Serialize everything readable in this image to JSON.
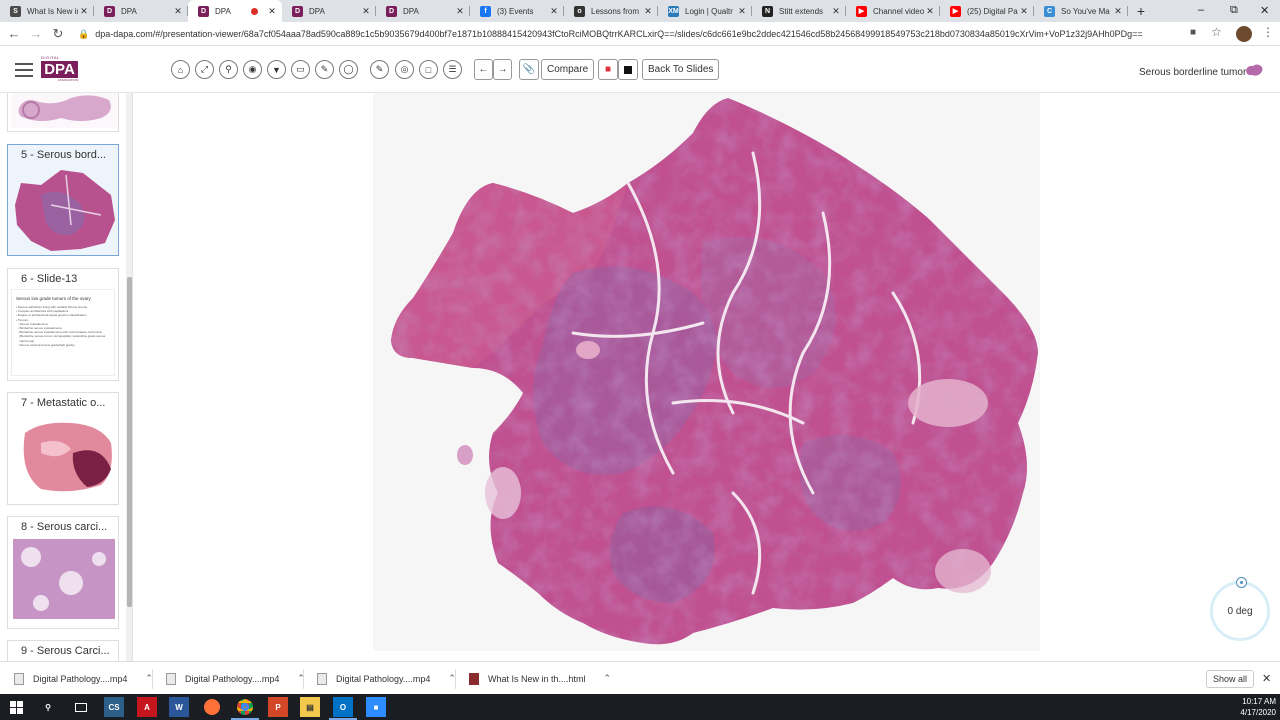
{
  "browser": {
    "tabs": [
      {
        "title": "What Is New in",
        "favicon": "page-icon",
        "color": "#4a4a4a",
        "glyph": "S",
        "active": false,
        "recording": false
      },
      {
        "title": "DPA",
        "favicon": "dpa-icon",
        "color": "#7a1f5c",
        "glyph": "D",
        "active": false,
        "recording": false
      },
      {
        "title": "DPA",
        "favicon": "dpa-icon",
        "color": "#7a1f5c",
        "glyph": "D",
        "active": true,
        "recording": true
      },
      {
        "title": "DPA",
        "favicon": "dpa-icon",
        "color": "#7a1f5c",
        "glyph": "D",
        "active": false,
        "recording": false
      },
      {
        "title": "DPA",
        "favicon": "dpa-icon",
        "color": "#7a1f5c",
        "glyph": "D",
        "active": false,
        "recording": false
      },
      {
        "title": "(3) Events",
        "favicon": "facebook-icon",
        "color": "#1877f2",
        "glyph": "f",
        "active": false,
        "recording": false
      },
      {
        "title": "Lessons from",
        "favicon": "github-icon",
        "color": "#333333",
        "glyph": "o",
        "active": false,
        "recording": false
      },
      {
        "title": "Login | Qualtr",
        "favicon": "qualtrics-icon",
        "color": "#2b7bb9",
        "glyph": "XM",
        "active": false,
        "recording": false
      },
      {
        "title": "Stitt extends",
        "favicon": "news-icon",
        "color": "#222222",
        "glyph": "N",
        "active": false,
        "recording": false
      },
      {
        "title": "Channel video",
        "favicon": "youtube-icon",
        "color": "#ff0000",
        "glyph": "▶",
        "active": false,
        "recording": false
      },
      {
        "title": "(25) Digital Pa",
        "favicon": "youtube-icon",
        "color": "#ff0000",
        "glyph": "▶",
        "active": false,
        "recording": false
      },
      {
        "title": "So You've Ma",
        "favicon": "site-icon",
        "color": "#3b8ed6",
        "glyph": "C",
        "active": false,
        "recording": false
      }
    ],
    "new_tab": "+",
    "url": "dpa-dapa.com/#/presentation-viewer/68a7cf054aaa78ad590ca889c1c5b9035679d400bf7e1871b10888415420943fCtoRciMOBQtrrKARCLxirQ==/slides/c6dc661e9bc2ddec421546cd58b24568499918549753c218bd0730834a85019cXrVim+VoP1z32j9AHh0PDg=="
  },
  "toolbar": {
    "compare_label": "Compare",
    "back_label": "Back To Slides",
    "slide_title": "Serous borderline tumor"
  },
  "logo": {
    "text": "DPA",
    "top_line": "DIGITAL PATHOLOGY",
    "bottom_line": "ASSOCIATION"
  },
  "sidebar": {
    "slides": [
      {
        "label": "5 - Serous bord..."
      },
      {
        "label": "6 - Slide-13"
      },
      {
        "label": "7 - Metastatic o..."
      },
      {
        "label": "8 - Serous carci..."
      },
      {
        "label": "9 - Serous Carci..."
      }
    ],
    "slide6_doc": {
      "title": "Serous low grade tumors of the ovary",
      "lines": [
        "• Serous epithelium lining with variable fibrous stroma",
        "• Complex architecture with papillations",
        "• Degree of architectural atypia governs classification",
        "• Tumors:",
        "  - Serous cystadenoma",
        "  - Borderline serous cystadenoma",
        "  - Borderline serous cystadenoma with microinvasive carcinoma",
        "    (Borderline serous tumor micropapillary variant/low grade serous",
        "    carcinoma)",
        "  - Serous carcinoma (low grade/high grade)"
      ]
    }
  },
  "viewer": {
    "rotation": "0 deg"
  },
  "downloads": {
    "items": [
      {
        "name": "Digital Pathology....mp4"
      },
      {
        "name": "Digital Pathology....mp4"
      },
      {
        "name": "Digital Pathology....mp4"
      },
      {
        "name": "What Is New in th....html"
      }
    ],
    "show_all": "Show all"
  },
  "taskbar": {
    "time": "10:17 AM",
    "date": "4/17/2020"
  }
}
